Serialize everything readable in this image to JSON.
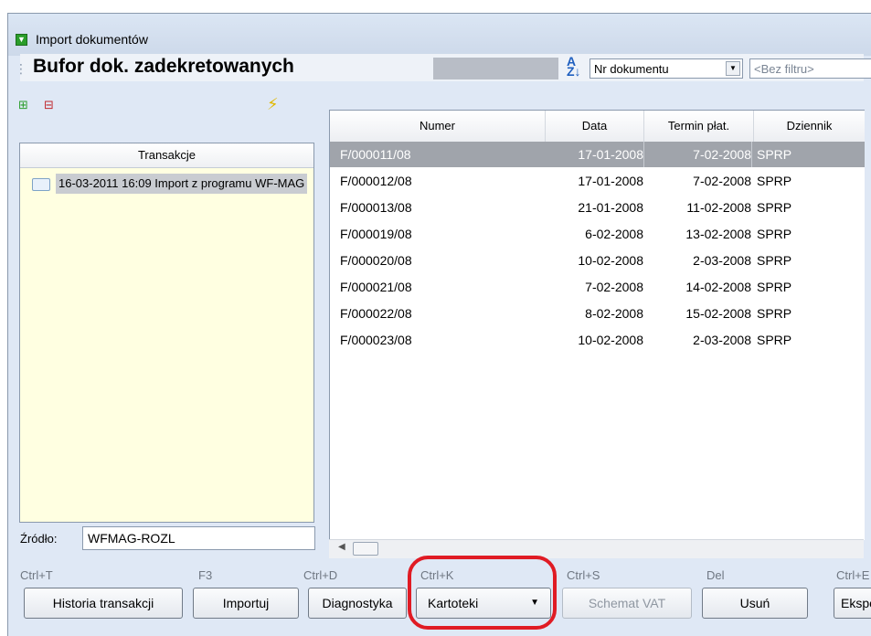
{
  "window": {
    "title": "Import dokumentów"
  },
  "header": {
    "title": "Bufor dok. zadekretowanych",
    "sort_field": "Nr dokumentu",
    "filter_placeholder": "<Bez filtru>"
  },
  "left_panel": {
    "column_header": "Transakcje",
    "items": [
      {
        "label": "16-03-2011 16:09 Import z programu WF-MAG"
      }
    ],
    "source_label": "Źródło:",
    "source_value": "WFMAG-ROZL"
  },
  "grid": {
    "columns": [
      "Numer",
      "Data",
      "Termin płat.",
      "Dziennik"
    ],
    "rows": [
      {
        "numer": "F/000011/08",
        "data": "17-01-2008",
        "termin": "7-02-2008",
        "dziennik": "SPRP",
        "selected": true
      },
      {
        "numer": "F/000012/08",
        "data": "17-01-2008",
        "termin": "7-02-2008",
        "dziennik": "SPRP"
      },
      {
        "numer": "F/000013/08",
        "data": "21-01-2008",
        "termin": "11-02-2008",
        "dziennik": "SPRP"
      },
      {
        "numer": "F/000019/08",
        "data": "6-02-2008",
        "termin": "13-02-2008",
        "dziennik": "SPRP"
      },
      {
        "numer": "F/000020/08",
        "data": "10-02-2008",
        "termin": "2-03-2008",
        "dziennik": "SPRP"
      },
      {
        "numer": "F/000021/08",
        "data": "7-02-2008",
        "termin": "14-02-2008",
        "dziennik": "SPRP"
      },
      {
        "numer": "F/000022/08",
        "data": "8-02-2008",
        "termin": "15-02-2008",
        "dziennik": "SPRP"
      },
      {
        "numer": "F/000023/08",
        "data": "10-02-2008",
        "termin": "2-03-2008",
        "dziennik": "SPRP"
      }
    ]
  },
  "buttons": [
    {
      "shortcut": "Ctrl+T",
      "label": "Historia transakcji"
    },
    {
      "shortcut": "F3",
      "label": "Importuj"
    },
    {
      "shortcut": "Ctrl+D",
      "label": "Diagnostyka"
    },
    {
      "shortcut": "Ctrl+K",
      "label": "Kartoteki"
    },
    {
      "shortcut": "Ctrl+S",
      "label": "Schemat VAT",
      "disabled": true
    },
    {
      "shortcut": "Del",
      "label": "Usuń"
    },
    {
      "shortcut": "Ctrl+E",
      "label": "Eksportuj"
    }
  ],
  "colors": {
    "selected_row": "#a0a4ab",
    "panel_background": "#ffffe1",
    "highlight": "#e01b24"
  }
}
